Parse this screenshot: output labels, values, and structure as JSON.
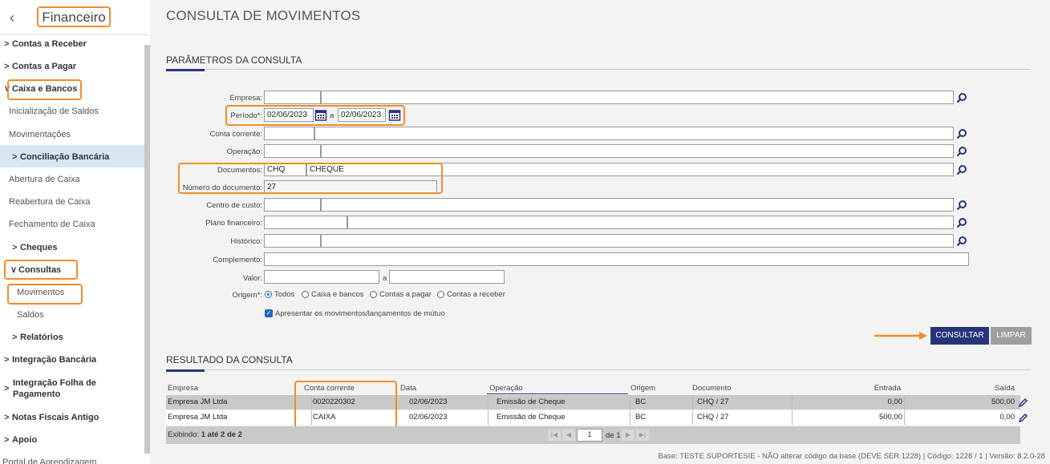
{
  "sidebar": {
    "title": "Financeiro",
    "items": [
      {
        "label": "Contas a Receber",
        "chev": ">"
      },
      {
        "label": "Contas a Pagar",
        "chev": ">"
      },
      {
        "label": "Caixa e Bancos",
        "chev": "∨"
      },
      {
        "label": "Inicialização de Saldos"
      },
      {
        "label": "Movimentações"
      },
      {
        "label": "Conciliação Bancária",
        "chev": ">"
      },
      {
        "label": "Abertura de Caixa"
      },
      {
        "label": "Reabertura de Caixa"
      },
      {
        "label": "Fechamento de Caixa"
      },
      {
        "label": "Cheques",
        "chev": ">"
      },
      {
        "label": "Consultas",
        "chev": "∨"
      },
      {
        "label": "Movimentos"
      },
      {
        "label": "Saldos"
      },
      {
        "label": "Relatórios",
        "chev": ">"
      },
      {
        "label": "Integração Bancária",
        "chev": ">"
      },
      {
        "label": "Integração Folha de",
        "label2": "Pagamento",
        "chev": ">"
      },
      {
        "label": "Notas Fiscais Antigo",
        "chev": ">"
      },
      {
        "label": "Apoio",
        "chev": ">"
      },
      {
        "label": "Portal de Aprendizagem"
      }
    ]
  },
  "page": {
    "title": "CONSULTA DE MOVIMENTOS",
    "params_title": "PARÂMETROS DA CONSULTA",
    "result_title": "RESULTADO DA CONSULTA"
  },
  "form": {
    "empresa_label": "Empresa:",
    "periodo_label": "Período*:",
    "periodo_de": "02/06/2023",
    "periodo_sep": "a",
    "periodo_ate": "02/06/2023",
    "conta_label": "Conta corrente:",
    "operacao_label": "Operação:",
    "documentos_label": "Documentos:",
    "documentos_code": "CHQ",
    "documentos_desc": "CHEQUE",
    "numero_label": "Número do documento:",
    "numero_value": "27",
    "centro_label": "Centro de custo:",
    "plano_label": "Plano financeiro:",
    "historico_label": "Histórico:",
    "complemento_label": "Complemento:",
    "valor_label": "Valor:",
    "valor_sep": "a",
    "origem_label": "Origem*:",
    "origem_options": [
      "Todos",
      "Caixa e bancos",
      "Contas a pagar",
      "Contas a receber"
    ],
    "origem_selected": "Todos",
    "mutuo_label": "Apresentar os movimentos/lançamentos de mútuo",
    "mutuo_checked": true
  },
  "buttons": {
    "consultar": "CONSULTAR",
    "limpar": "LIMPAR"
  },
  "table": {
    "columns": [
      "Empresa",
      "Conta corrente",
      "Data",
      "Operação",
      "Origem",
      "Documento",
      "Entrada",
      "Saída"
    ],
    "rows": [
      {
        "empresa": "Empresa JM Ltda",
        "conta": "0020220302",
        "data": "02/06/2023",
        "operacao": "Emissão de Cheque",
        "origem": "BC",
        "documento": "CHQ / 27",
        "entrada": "0,00",
        "saida": "500,00"
      },
      {
        "empresa": "Empresa JM Ltda",
        "conta": "CAIXA",
        "data": "02/06/2023",
        "operacao": "Emissão de Cheque",
        "origem": "BC",
        "documento": "CHQ / 27",
        "entrada": "500,00",
        "saida": "0,00"
      }
    ],
    "exibindo_prefix": "Exibindo: ",
    "exibindo_range": "1 até 2 de 2",
    "page_current": "1",
    "page_of": "de 1"
  },
  "footer": {
    "text": "Base: TESTE SUPORTESIE - NÃO alterar código da base (DEVE SER 1228) | Código: 1228 / 1 | Versão: 8.2.0-28"
  },
  "colors": {
    "highlight": "#f28c28",
    "primary_button": "#26357a",
    "secondary_button": "#9e9e9e",
    "active_menu": "#d7e6f3"
  }
}
